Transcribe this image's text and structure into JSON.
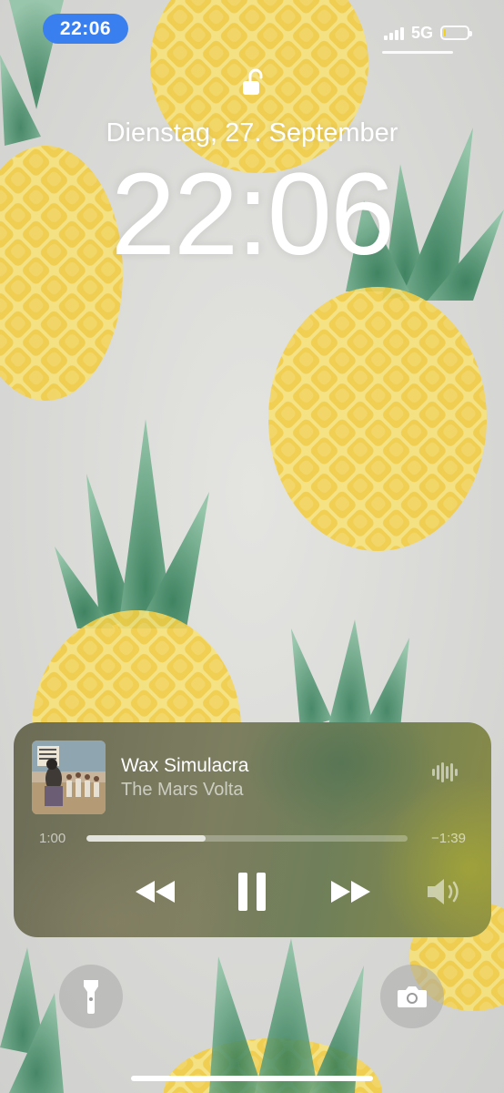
{
  "status_bar": {
    "time": "22:06",
    "network": "5G",
    "battery_level": 0.2,
    "signal_bars": 4,
    "colors": {
      "time_pill": "#3a7ff0",
      "battery_fill": "#f5d213"
    }
  },
  "lock_screen": {
    "lock_icon": "unlocked-padlock-icon",
    "date": "Dienstag, 27. September",
    "time": "22:06"
  },
  "now_playing": {
    "album_art": "album-cover-icon",
    "title": "Wax Simulacra",
    "artist": "The Mars Volta",
    "elapsed": "1:00",
    "remaining": "−1:39",
    "progress": 0.37,
    "controls": {
      "rewind": "rewind-icon",
      "pause": "pause-icon",
      "forward": "fast-forward-icon",
      "volume": "speaker-icon",
      "audio_output": "waveform-icon"
    }
  },
  "quick_actions": {
    "left": "flashlight-icon",
    "right": "camera-icon"
  },
  "wallpaper": {
    "motif": "watercolor-pineapple-icon",
    "colors": {
      "background": "#dcdcd9",
      "fruit": "#f2d64a",
      "leaves": "#4e9a6a"
    }
  }
}
